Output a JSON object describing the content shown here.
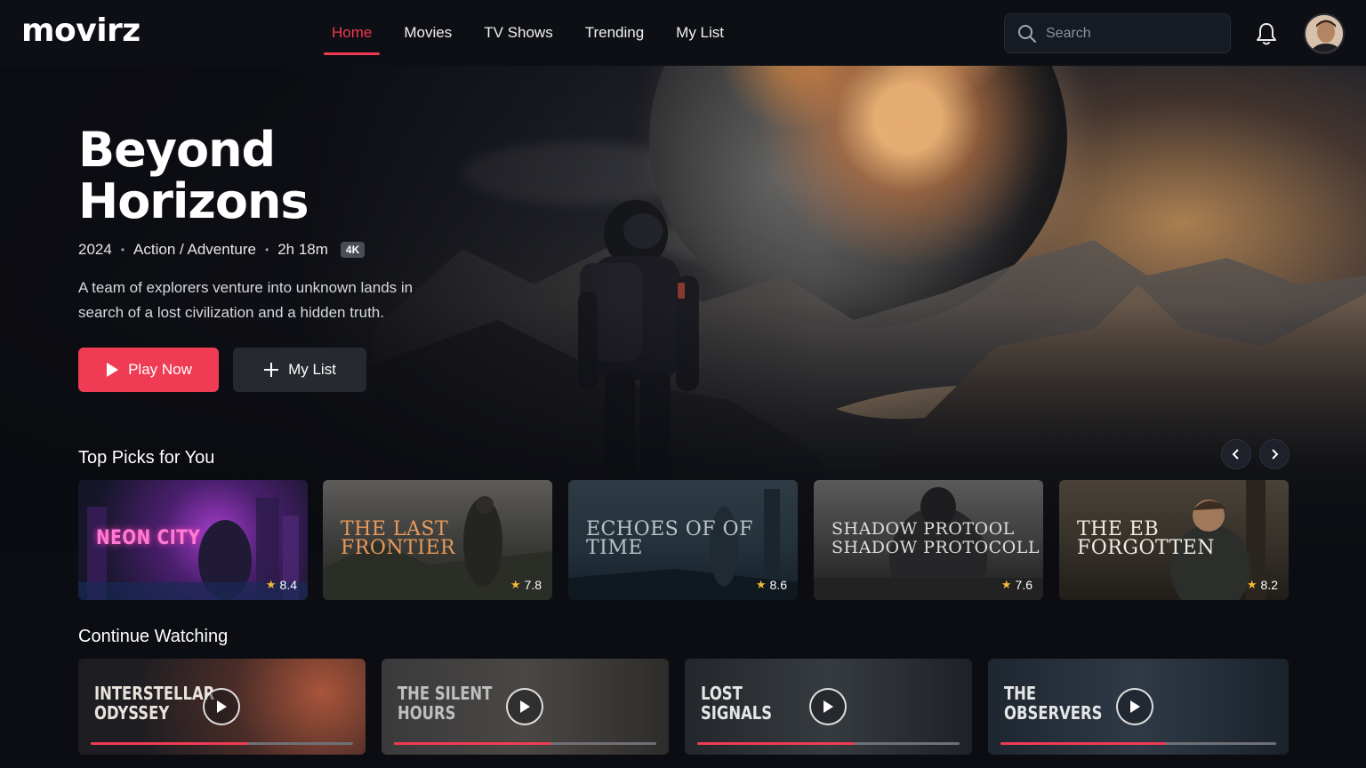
{
  "app": {
    "logo": "movirz"
  },
  "nav": {
    "items": [
      {
        "label": "Home",
        "active": true
      },
      {
        "label": "Movies",
        "active": false
      },
      {
        "label": "TV Shows",
        "active": false
      },
      {
        "label": "Trending",
        "active": false
      },
      {
        "label": "My List",
        "active": false
      }
    ],
    "search_placeholder": "Search",
    "icons": {
      "search": "search-icon",
      "notifications": "bell-icon",
      "profile": "avatar"
    }
  },
  "hero": {
    "title": "Beyond Horizons",
    "year": "2024",
    "genre": "Action / Adventure",
    "duration": "2h 18m",
    "quality": "4K",
    "description": "A team of explorers venture into unknown lands in search of a lost civilization and a hidden truth.",
    "play_label": "Play Now",
    "list_label": "My List"
  },
  "top_picks": {
    "title": "Top Picks for You",
    "items": [
      {
        "title": "NEON CITY",
        "rating": "8.4"
      },
      {
        "title": "THE LAST FRONTIER",
        "rating": "7.8"
      },
      {
        "title": "ECHOES OF OF TIME",
        "rating": "8.6"
      },
      {
        "title": "SHADOW PROTOOL SHADOW PROTOCOLL",
        "rating": "7.6"
      },
      {
        "title": "THE EB FORGOTTEN",
        "rating": "8.2"
      }
    ]
  },
  "continue_watching": {
    "title": "Continue Watching",
    "items": [
      {
        "title": "INTERSTELLAR ODYSSEY",
        "progress": 0.6
      },
      {
        "title": "THE SILENT HOURS",
        "progress": 0.6
      },
      {
        "title": "LOST SIGNALS",
        "progress": 0.6
      },
      {
        "title": "THE OBSERVERS",
        "progress": 0.6
      }
    ]
  },
  "colors": {
    "accent": "#ef3b53",
    "background": "#0b0d12",
    "star": "#f5b933"
  }
}
